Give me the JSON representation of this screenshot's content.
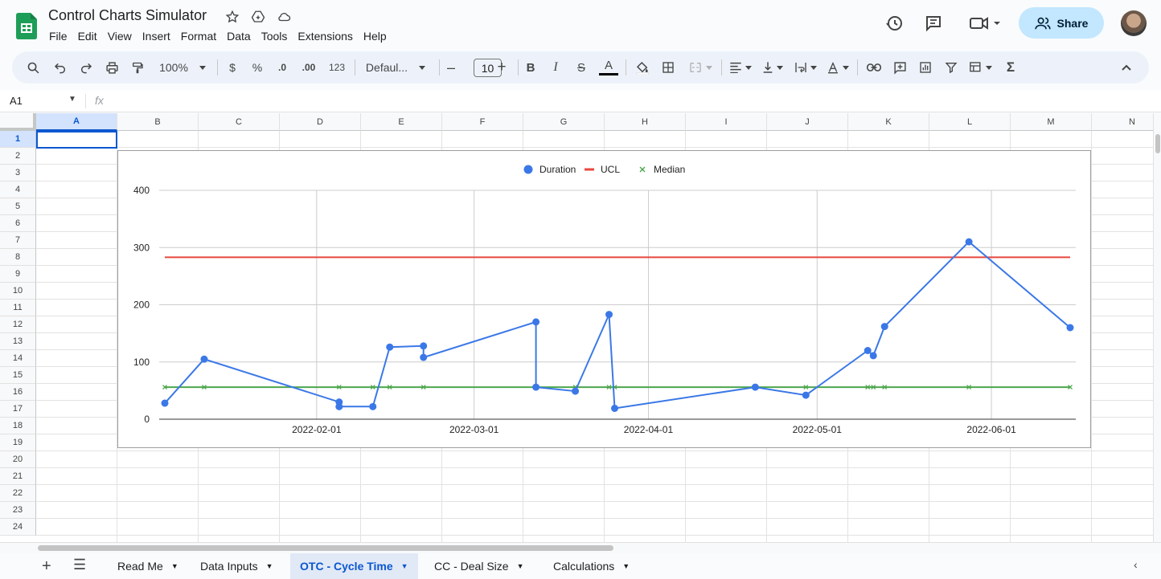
{
  "app": {
    "title": "Control Charts Simulator",
    "share_label": "Share",
    "menu": [
      "File",
      "Edit",
      "View",
      "Insert",
      "Format",
      "Data",
      "Tools",
      "Extensions",
      "Help"
    ]
  },
  "toolbar": {
    "zoom": "100%",
    "currency": "$",
    "percent": "%",
    "dec_decrease": ".0",
    "dec_increase": ".00",
    "number_format": "123",
    "font": "Defaul...",
    "font_size": "10",
    "minus": "–",
    "plus": "+",
    "bold": "B",
    "italic": "I",
    "strike": "S",
    "text_color": "A",
    "sum": "Σ"
  },
  "formula_bar": {
    "cell_ref": "A1",
    "fx": "fx"
  },
  "grid": {
    "columns": [
      "A",
      "B",
      "C",
      "D",
      "E",
      "F",
      "G",
      "H",
      "I",
      "J",
      "K",
      "L",
      "M",
      "N"
    ],
    "rows": [
      "1",
      "2",
      "3",
      "4",
      "5",
      "6",
      "7",
      "8",
      "9",
      "10",
      "11",
      "12",
      "13",
      "14",
      "15",
      "16",
      "17",
      "18",
      "19",
      "20",
      "21",
      "22",
      "23",
      "24"
    ]
  },
  "chart_data": {
    "type": "line",
    "title": "",
    "legend": [
      "Duration",
      "UCL",
      "Median"
    ],
    "legend_position": "top",
    "colors": {
      "Duration": "#3b78e7",
      "UCL": "#e8473f",
      "Median": "#4ca64c"
    },
    "y_ticks": [
      "0",
      "100",
      "200",
      "300",
      "400"
    ],
    "ylim": [
      0,
      400
    ],
    "x_ticks": [
      "2022-02-01",
      "2022-03-01",
      "2022-04-01",
      "2022-05-01",
      "2022-06-01"
    ],
    "xlim": [
      "2022-01-04",
      "2022-06-16"
    ],
    "series": [
      {
        "name": "Duration",
        "points": [
          {
            "x": "2022-01-05",
            "y": 28
          },
          {
            "x": "2022-01-12",
            "y": 105
          },
          {
            "x": "2022-02-05",
            "y": 30
          },
          {
            "x": "2022-02-05",
            "y": 22
          },
          {
            "x": "2022-02-11",
            "y": 22
          },
          {
            "x": "2022-02-14",
            "y": 126
          },
          {
            "x": "2022-02-20",
            "y": 128
          },
          {
            "x": "2022-02-20",
            "y": 108
          },
          {
            "x": "2022-03-12",
            "y": 170
          },
          {
            "x": "2022-03-12",
            "y": 56
          },
          {
            "x": "2022-03-19",
            "y": 49
          },
          {
            "x": "2022-03-25",
            "y": 183
          },
          {
            "x": "2022-03-26",
            "y": 19
          },
          {
            "x": "2022-04-20",
            "y": 56
          },
          {
            "x": "2022-04-29",
            "y": 42
          },
          {
            "x": "2022-05-10",
            "y": 120
          },
          {
            "x": "2022-05-11",
            "y": 111
          },
          {
            "x": "2022-05-13",
            "y": 162
          },
          {
            "x": "2022-05-28",
            "y": 310
          },
          {
            "x": "2022-06-15",
            "y": 160
          }
        ]
      },
      {
        "name": "UCL",
        "points": [
          {
            "x": "2022-01-05",
            "y": 283
          },
          {
            "x": "2022-06-15",
            "y": 283
          }
        ]
      },
      {
        "name": "Median",
        "value": 56,
        "x": [
          "2022-01-05",
          "2022-01-12",
          "2022-02-05",
          "2022-02-11",
          "2022-02-14",
          "2022-02-20",
          "2022-03-12",
          "2022-03-19",
          "2022-03-25",
          "2022-03-26",
          "2022-04-20",
          "2022-04-29",
          "2022-05-10",
          "2022-05-11",
          "2022-05-13",
          "2022-05-28",
          "2022-06-15"
        ]
      }
    ]
  },
  "sheets": [
    {
      "name": "Read Me"
    },
    {
      "name": "Data Inputs"
    },
    {
      "name": "OTC - Cycle Time",
      "active": true
    },
    {
      "name": "CC - Deal Size"
    },
    {
      "name": "Calculations"
    }
  ]
}
